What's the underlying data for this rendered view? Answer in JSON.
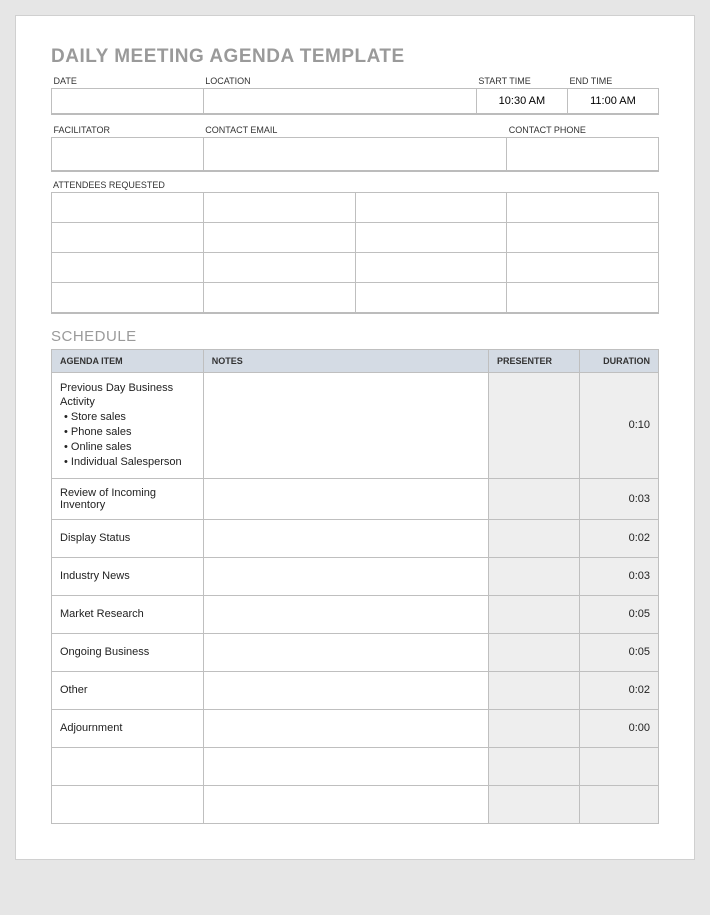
{
  "title": "DAILY MEETING AGENDA TEMPLATE",
  "info1": {
    "date_label": "DATE",
    "location_label": "LOCATION",
    "start_label": "START TIME",
    "end_label": "END TIME",
    "date": "",
    "location": "",
    "start": "10:30 AM",
    "end": "11:00 AM"
  },
  "info2": {
    "facilitator_label": "FACILITATOR",
    "email_label": "CONTACT EMAIL",
    "phone_label": "CONTACT PHONE",
    "facilitator": "",
    "email": "",
    "phone": ""
  },
  "attendees_label": "ATTENDEES REQUESTED",
  "schedule_heading": "SCHEDULE",
  "sched_headers": {
    "item": "AGENDA ITEM",
    "notes": "NOTES",
    "presenter": "PRESENTER",
    "duration": "DURATION"
  },
  "rows": [
    {
      "item": "Previous Day Business Activity",
      "subs": [
        "• Store sales",
        "• Phone sales",
        "• Online sales",
        "• Individual Salesperson"
      ],
      "notes": "",
      "presenter": "",
      "duration": "0:10"
    },
    {
      "item": "Review of Incoming Inventory",
      "notes": "",
      "presenter": "",
      "duration": "0:03"
    },
    {
      "item": "Display Status",
      "notes": "",
      "presenter": "",
      "duration": "0:02"
    },
    {
      "item": "Industry News",
      "notes": "",
      "presenter": "",
      "duration": "0:03"
    },
    {
      "item": "Market Research",
      "notes": "",
      "presenter": "",
      "duration": "0:05"
    },
    {
      "item": "Ongoing Business",
      "notes": "",
      "presenter": "",
      "duration": "0:05"
    },
    {
      "item": "Other",
      "notes": "",
      "presenter": "",
      "duration": "0:02"
    },
    {
      "item": "Adjournment",
      "notes": "",
      "presenter": "",
      "duration": "0:00"
    },
    {
      "item": "",
      "notes": "",
      "presenter": "",
      "duration": ""
    },
    {
      "item": "",
      "notes": "",
      "presenter": "",
      "duration": ""
    }
  ]
}
